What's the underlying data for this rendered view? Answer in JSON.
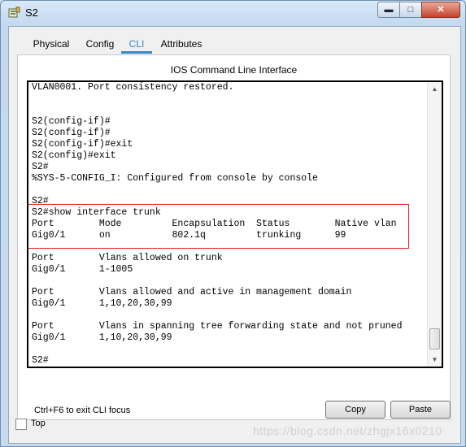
{
  "window": {
    "title": "S2"
  },
  "tabs": [
    {
      "label": "Physical"
    },
    {
      "label": "Config"
    },
    {
      "label": "CLI"
    },
    {
      "label": "Attributes"
    }
  ],
  "panel": {
    "title": "IOS Command Line Interface"
  },
  "terminal": {
    "lines": [
      "VLAN0001. Port consistency restored.",
      "",
      "",
      "S2(config-if)#",
      "S2(config-if)#",
      "S2(config-if)#exit",
      "S2(config)#exit",
      "S2#",
      "%SYS-5-CONFIG_I: Configured from console by console",
      "",
      "S2#",
      "S2#show interface trunk",
      "Port        Mode         Encapsulation  Status        Native vlan",
      "Gig0/1      on           802.1q         trunking      99",
      "",
      "Port        Vlans allowed on trunk",
      "Gig0/1      1-1005",
      "",
      "Port        Vlans allowed and active in management domain",
      "Gig0/1      1,10,20,30,99",
      "",
      "Port        Vlans in spanning tree forwarding state and not pruned",
      "Gig0/1      1,10,20,30,99",
      "",
      "S2#"
    ]
  },
  "footer": {
    "hint": "Ctrl+F6 to exit CLI focus",
    "copy_label": "Copy",
    "paste_label": "Paste"
  },
  "bottom": {
    "top_label": "Top",
    "watermark": "https://blog.csdn.net/zhgjx16x0210"
  }
}
